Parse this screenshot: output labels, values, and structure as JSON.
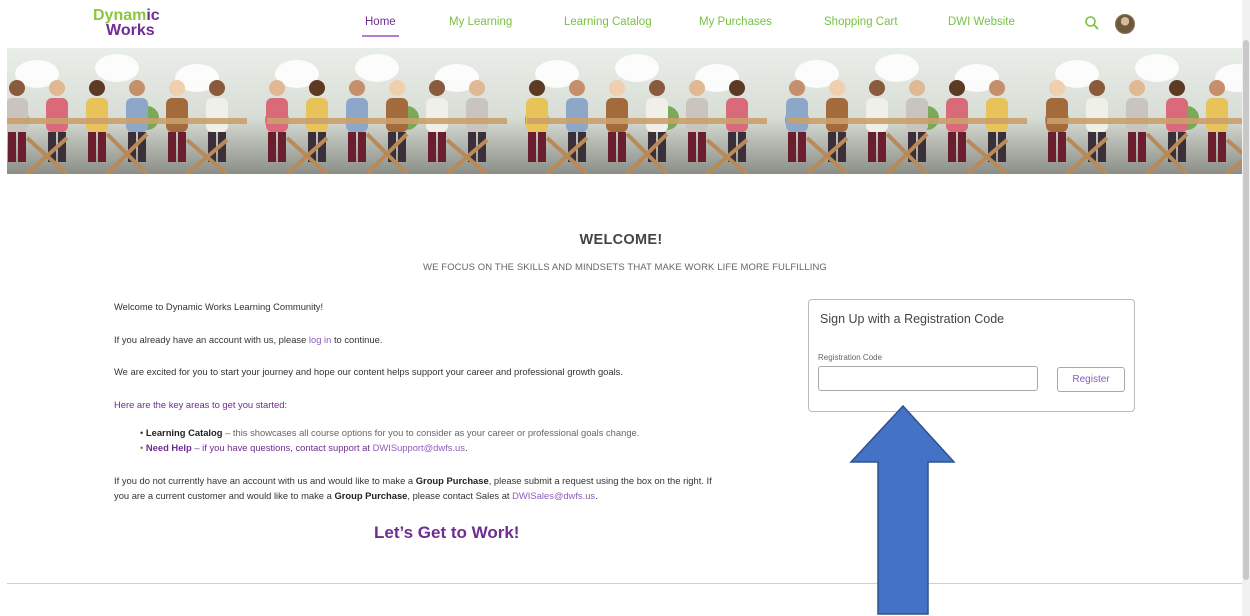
{
  "header": {
    "logo": {
      "line1_a": "Dynam",
      "line1_b": "ic",
      "line2": "Works"
    },
    "nav": [
      {
        "label": "Home",
        "active": true
      },
      {
        "label": "My Learning"
      },
      {
        "label": "Learning Catalog"
      },
      {
        "label": "My Purchases"
      },
      {
        "label": "Shopping Cart"
      },
      {
        "label": "DWI Website"
      }
    ],
    "icons": {
      "search": "search-icon",
      "avatar": "user-avatar"
    }
  },
  "colors": {
    "purple": "#6f2c91",
    "green": "#7ac143",
    "link": "#8d5dbd",
    "arrow": "#4472c4"
  },
  "welcome": {
    "title": "WELCOME!",
    "subtitle": "WE FOCUS ON THE SKILLS AND MINDSETS THAT MAKE WORK LIFE MORE FULFILLING"
  },
  "intro": {
    "heading": "Welcome to Dynamic Works Learning Community!",
    "login_pre": "If you already have an account with us, please ",
    "login_link": "log in",
    "login_post": " to continue.",
    "excited": "We are excited for you to start your journey and hope our content helps support your career and professional growth goals.",
    "key_areas": "Here are the key areas to get you started:",
    "bullets": [
      {
        "term": "Learning Catalog",
        "text": " – this showcases all course options for you to consider as your career or professional goals change."
      },
      {
        "term": "Need Help",
        "text": " – if you have questions, contact support at ",
        "link": "DWISupport@dwfs.us",
        "tail": "."
      }
    ],
    "group1_pre": "If you do not currently have an account with us and would like to make a ",
    "group1_bold": "Group Purchase",
    "group1_post": ", please submit a request using the box on the right. If",
    "group2_pre": "you are a current customer and would like to make a ",
    "group2_bold": "Group Purchase",
    "group2_mid": ", please contact Sales at ",
    "group2_link": "DWISales@dwfs.us",
    "group2_tail": ".",
    "cta": "Let’s Get to Work!"
  },
  "signup": {
    "title": "Sign Up with a Registration Code",
    "field_label": "Registration Code",
    "field_value": "",
    "button": "Register"
  }
}
